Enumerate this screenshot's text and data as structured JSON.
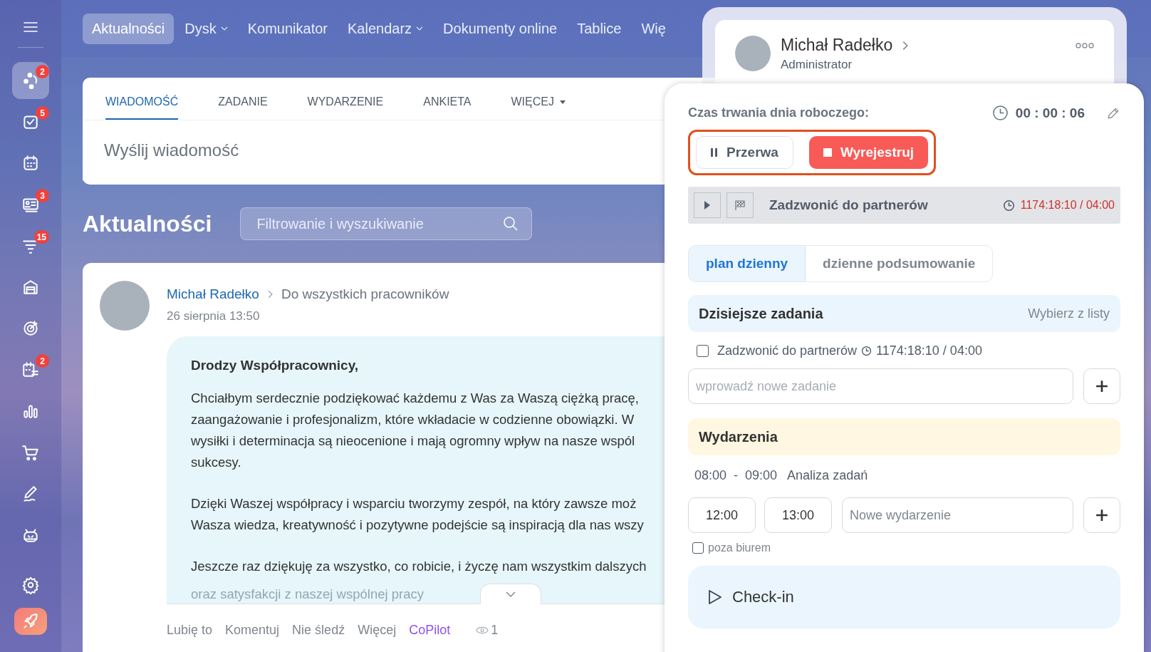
{
  "sidebar": {
    "items": [
      {
        "selected": true,
        "badge": "2"
      },
      {
        "selected": false,
        "badge": "5"
      },
      {
        "selected": false
      },
      {
        "selected": false,
        "badge": "3"
      },
      {
        "selected": false,
        "badge": "15"
      },
      {
        "selected": false
      },
      {
        "selected": false
      },
      {
        "selected": false,
        "badge": "2"
      },
      {
        "selected": false
      },
      {
        "selected": false
      },
      {
        "selected": false
      },
      {
        "selected": false
      },
      {
        "selected": false
      },
      {
        "selected": false
      }
    ]
  },
  "top_nav": [
    {
      "label": "Aktualności",
      "selected": true,
      "dropdown": false
    },
    {
      "label": "Dysk",
      "selected": false,
      "dropdown": true
    },
    {
      "label": "Komunikator",
      "selected": false,
      "dropdown": false
    },
    {
      "label": "Kalendarz",
      "selected": false,
      "dropdown": true
    },
    {
      "label": "Dokumenty online",
      "selected": false,
      "dropdown": false
    },
    {
      "label": "Tablice",
      "selected": false,
      "dropdown": false
    },
    {
      "label": "Wię",
      "selected": false,
      "dropdown": false
    }
  ],
  "composer": {
    "tabs": [
      {
        "label": "WIADOMOŚĆ",
        "selected": true,
        "dropdown": false
      },
      {
        "label": "ZADANIE",
        "selected": false,
        "dropdown": false
      },
      {
        "label": "WYDARZENIE",
        "selected": false,
        "dropdown": false
      },
      {
        "label": "ANKIETA",
        "selected": false,
        "dropdown": false
      },
      {
        "label": "WIĘCEJ",
        "selected": false,
        "dropdown": true
      }
    ],
    "placeholder": "Wyślij wiadomość"
  },
  "feed": {
    "title": "Aktualności",
    "search_placeholder": "Filtrowanie i wyszukiwanie"
  },
  "post": {
    "author": "Michał Radełko",
    "recipient": "Do wszystkich pracowników",
    "date": "26 sierpnia 13:50",
    "greeting": "Drodzy Współpracownicy,",
    "paragraphs": [
      [
        "Chciałbym serdecznie podziękować każdemu z Was za Waszą ciężką pracę,",
        "zaangażowanie i profesjonalizm, które wkładacie w codzienne obowiązki. W",
        "wysiłki i determinacja są nieocenione i mają ogromny wpływ na nasze wspól",
        "sukcesy."
      ],
      [
        "Dzięki Waszej współpracy i wsparciu tworzymy zespół, na który zawsze moż",
        "Wasza wiedza, kreatywność i pozytywne podejście są inspiracją dla nas wszy"
      ],
      [
        "Jeszcze raz dziękuję za wszystko, co robicie, i życzę nam wszystkim dalszych"
      ]
    ],
    "faded_line": "oraz satysfakcji z naszej wspólnej pracy",
    "actions": [
      {
        "label": "Lubię to",
        "kind": "plain"
      },
      {
        "label": "Komentuj",
        "kind": "plain"
      },
      {
        "label": "Nie śledź",
        "kind": "plain"
      },
      {
        "label": "Więcej",
        "kind": "plain"
      },
      {
        "label": "CoPilot",
        "kind": "accent"
      }
    ],
    "views": "1"
  },
  "profile": {
    "name": "Michał Radełko",
    "role": "Administrator"
  },
  "workday": {
    "label": "Czas trwania dnia roboczego:",
    "time": "00 : 00 : 06",
    "pause_button": "Przerwa",
    "stop_button": "Wyrejestruj",
    "current_task": {
      "title": "Zadzwonić do partnerów",
      "time": "1174:18:10 / 04:00"
    },
    "tabs": [
      {
        "label": "plan dzienny",
        "selected": true
      },
      {
        "label": "dzienne podsumowanie",
        "selected": false
      }
    ],
    "tasks_title": "Dzisiejsze zadania",
    "tasks_link": "Wybierz z listy",
    "tasks": [
      {
        "title": "Zadzwonić do partnerów",
        "time": "1174:18:10 / 04:00",
        "checked": false
      }
    ],
    "new_task_placeholder": "wprowadź nowe zadanie",
    "events_title": "Wydarzenia",
    "events": [
      {
        "start": "08:00",
        "separator": "-",
        "end": "09:00",
        "title": "Analiza zadań"
      }
    ],
    "new_event": {
      "start": "12:00",
      "end": "13:00",
      "placeholder": "Nowe wydarzenie"
    },
    "out_of_office": {
      "label": "poza biurem",
      "checked": false
    },
    "checkin_button": "Check-in"
  }
}
